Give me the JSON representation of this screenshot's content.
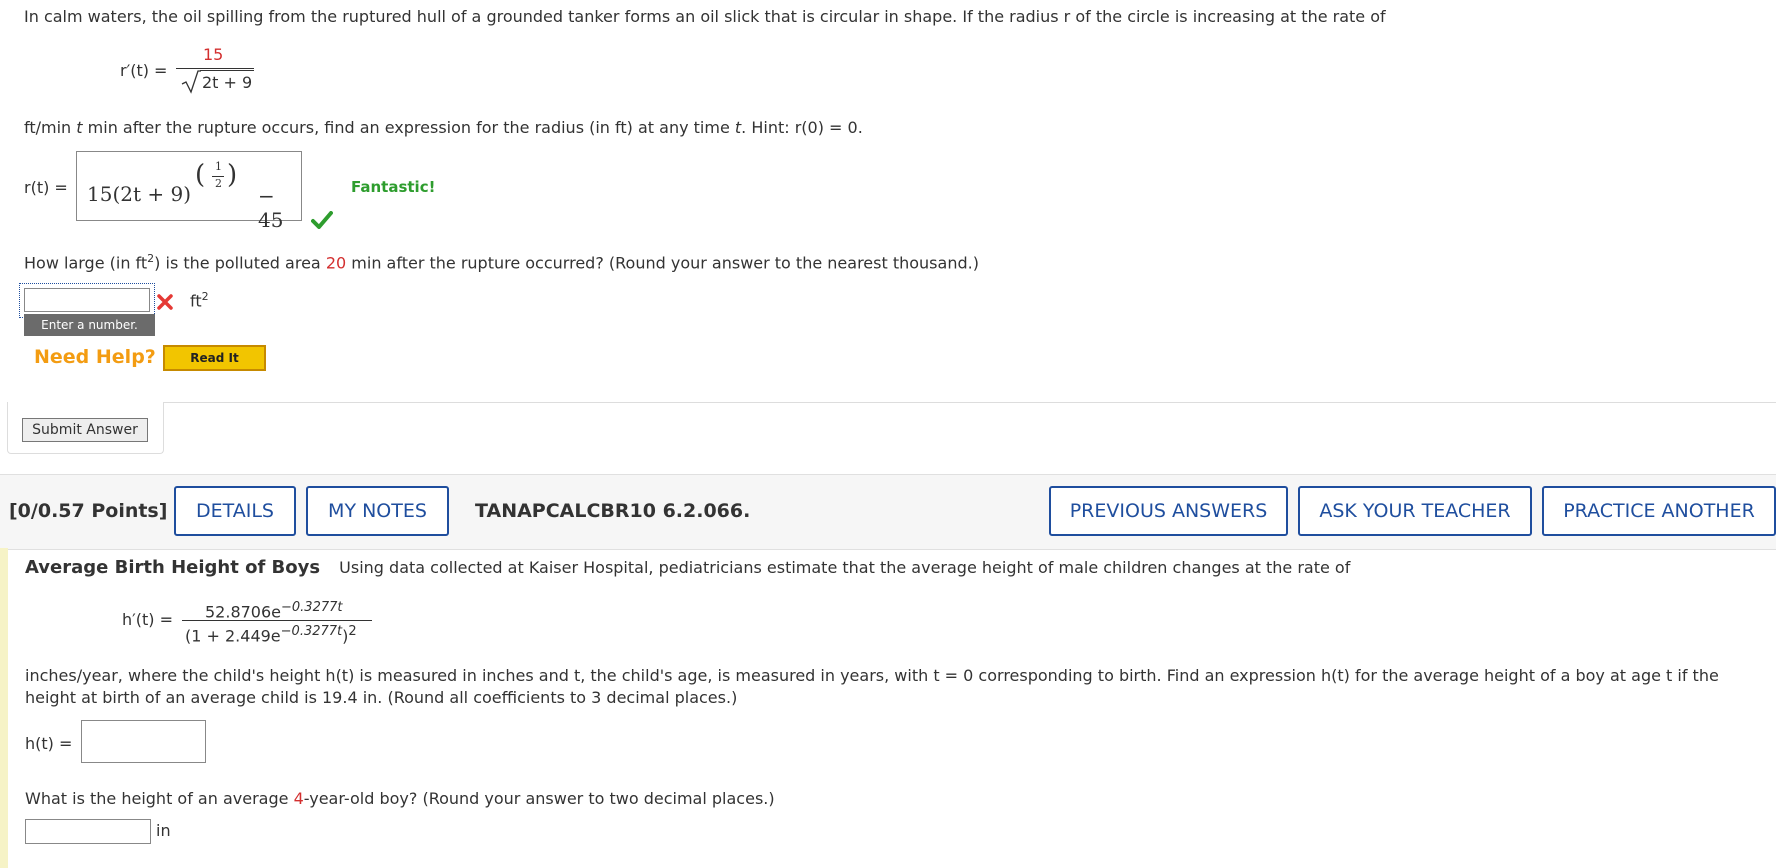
{
  "q1": {
    "intro": "In calm waters, the oil spilling from the ruptured hull of a grounded tanker forms an oil slick that is circular in shape. If the radius r of the circle is increasing at the rate of",
    "rate_lhs": "r′(t) =",
    "rate_num": "15",
    "rate_den": "2t + 9",
    "unit_text_1": "ft/min",
    "unit_text_2": "t",
    "unit_text_3": "min after the rupture occurs, find an expression for the radius (in ft) at any time",
    "unit_text_4": "t",
    "unit_text_5": ". Hint:",
    "hint": "r(0) = 0.",
    "answer_lhs": "r(t) =",
    "answer_expr_a": "15(2t + 9)",
    "answer_exp_num": "1",
    "answer_exp_den": "2",
    "answer_expr_b": "− 45",
    "feedback": "Fantastic!",
    "part2_a": "How large (in ft",
    "part2_sup": "2",
    "part2_b": ") is the polluted area",
    "part2_val": "20",
    "part2_c": "min after the rupture occurred? (Round your answer to the nearest thousand.)",
    "part2_input": "",
    "part2_unit": "ft",
    "part2_unit_sup": "2",
    "tooltip": "Enter a number.",
    "need_help": "Need Help?",
    "read_it": "Read It",
    "submit": "Submit Answer"
  },
  "q2": {
    "points": "[0/0.57 Points]",
    "details": "DETAILS",
    "my_notes": "MY NOTES",
    "code": "TANAPCALCBR10 6.2.066.",
    "prev_answers": "PREVIOUS ANSWERS",
    "ask_teacher": "ASK YOUR TEACHER",
    "practice": "PRACTICE ANOTHER",
    "title": "Average Birth Height of Boys",
    "intro": "Using data collected at Kaiser Hospital, pediatricians estimate that the average height of male children changes at the rate of",
    "rate_lhs": "h′(t) =",
    "rate_num": "52.8706e",
    "rate_num_exp": "−0.3277t",
    "rate_den": "(1 + 2.449e",
    "rate_den_exp": "−0.3277t",
    "rate_den_b": ")",
    "rate_den_sq": "2",
    "para": "inches/year, where the child's height h(t) is measured in inches and t, the child's age, is measured in years, with t = 0 corresponding to birth. Find an expression h(t) for the average height of a boy at age t if the",
    "para2": "height at birth of an average child is 19.4 in. (Round all coefficients to 3 decimal places.)",
    "answer_lhs": "h(t) =",
    "answer_input": "",
    "part2_a": "What is the height of an average",
    "part2_val": "4",
    "part2_b": "-year-old boy? (Round your answer to two decimal places.)",
    "part2_input": "",
    "part2_unit": "in"
  },
  "colors": {
    "accent": "#1f4e9e",
    "correct": "#2e9d2e",
    "wrong": "#e53935",
    "help": "#f39c12",
    "highlight": "#d32f2f"
  }
}
